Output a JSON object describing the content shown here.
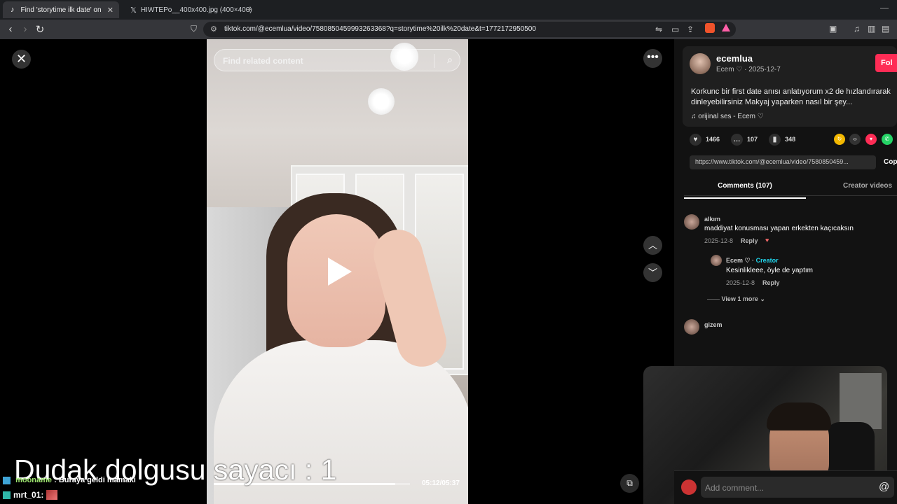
{
  "browser": {
    "tabs": [
      {
        "title": "Find 'storytime ilk date' on TikTo",
        "icon": "tiktok-icon",
        "active": true
      },
      {
        "title": "HIWTEPo__400x400.jpg (400×400)",
        "icon": "x-logo-icon",
        "active": false
      }
    ],
    "url": "tiktok.com/@ecemlua/video/7580850459993263368?q=storytime%20ilk%20date&t=1772172950500"
  },
  "video": {
    "search_placeholder": "Find related content",
    "time": "05:12/05:37",
    "progress": 0.925
  },
  "post": {
    "username": "ecemlua",
    "subtitle": "Ecem ♡ · 2025-12-7",
    "follow_label": "Fol",
    "description": "Korkunc bir first date anısı anlatıyorum x2 de hızlandırarak dinleyebilirsiniz Makyaj yaparken nasıl bir şey...",
    "music": "orijinal ses - Ecem ♡",
    "likes": "1466",
    "comments": "107",
    "saves": "348",
    "link": "https://www.tiktok.com/@ecemlua/video/7580850459...",
    "copy_label": "Cop"
  },
  "tabs": {
    "comments": "Comments (107)",
    "creator_videos": "Creator videos"
  },
  "comments": [
    {
      "name": "alkım",
      "text": "maddiyat konusması yapan erkekten kaçıcaksın",
      "date": "2025-12-8",
      "reply": "Reply"
    },
    {
      "name": "Ecem ♡",
      "creator": "Creator",
      "text": "Kesinlikleee, öyle de yaptım",
      "date": "2025-12-8",
      "reply": "Reply"
    },
    {
      "name": "gizem",
      "text": "",
      "date": "",
      "reply": ""
    }
  ],
  "view_more": "View 1 more",
  "comment_input_placeholder": "Add comment...",
  "overlay": {
    "counter": "Dudak dolgusu  sayacı : 1",
    "chat": [
      {
        "user": "mooname",
        "text": ": Buraya geldi mamaki"
      },
      {
        "user": "mrt_01",
        "text": ":"
      }
    ]
  }
}
